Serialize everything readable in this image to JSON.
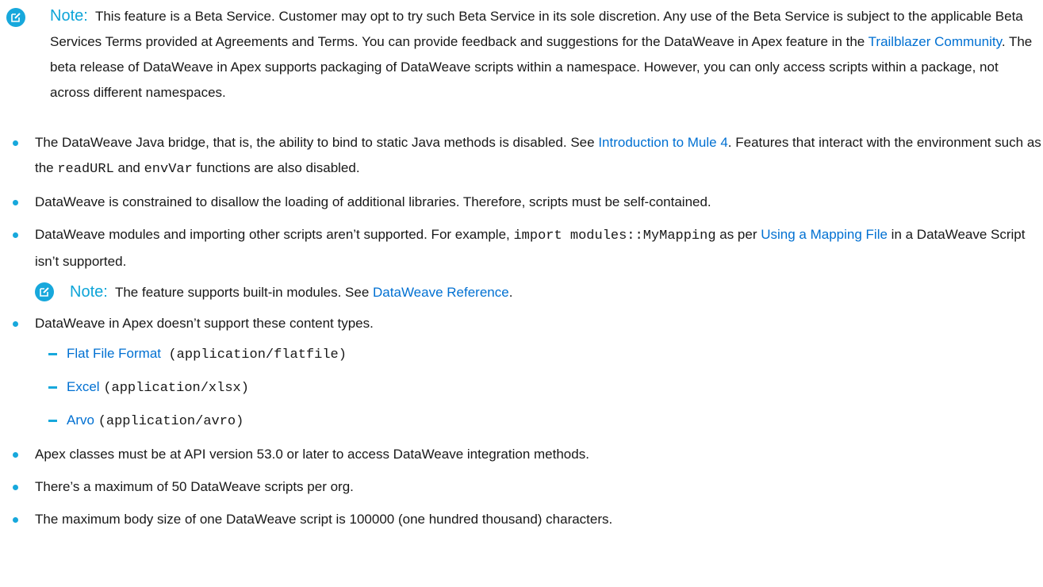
{
  "note_top": {
    "label": "Note:",
    "part1": "This feature is a Beta Service. Customer may opt to try such Beta Service in its sole discretion. Any use of the Beta Service is subject to the applicable Beta Services Terms provided at Agreements and Terms. You can provide feedback and suggestions for the DataWeave in Apex feature in the ",
    "link": "Trailblazer Community",
    "part2": ". The beta release of DataWeave in Apex supports packaging of DataWeave scripts within a namespace. However, you can only access scripts within a package, not across different namespaces."
  },
  "bullet1": {
    "t1": "The DataWeave Java bridge, that is, the ability to bind to static Java methods is disabled. See ",
    "link": "Introduction to Mule 4",
    "t2": ". Features that interact with the environment such as the ",
    "code1": "readURL",
    "t3": " and ",
    "code2": "envVar",
    "t4": " functions are also disabled."
  },
  "bullet2": "DataWeave is constrained to disallow the loading of additional libraries. Therefore, scripts must be self-contained.",
  "bullet3": {
    "t1": "DataWeave modules and importing other scripts aren’t supported. For example, ",
    "code": "import modules::MyMapping",
    "t2": " as per ",
    "link": "Using a Mapping File",
    "t3": " in a DataWeave Script isn’t supported.",
    "note_label": "Note:",
    "note_text": "The feature supports built-in modules. See ",
    "note_link": "DataWeave Reference",
    "note_end": "."
  },
  "bullet4": {
    "text": "DataWeave in Apex doesn’t support these content types.",
    "items": [
      {
        "link": "Flat File Format",
        "code": "(application/flatfile)"
      },
      {
        "link": "Excel",
        "code": "(application/xlsx)"
      },
      {
        "link": "Arvo",
        "code": "(application/avro)"
      }
    ]
  },
  "bullet5": "Apex classes must be at API version 53.0 or later to access DataWeave integration methods.",
  "bullet6": "There’s a maximum of 50 DataWeave scripts per org.",
  "bullet7": "The maximum body size of one DataWeave script is 100000 (one hundred thousand) characters.",
  "colors": {
    "accent": "#17a8dc",
    "link": "#0070d2",
    "text": "#181818"
  },
  "icons": {
    "note": "edit-note-icon"
  }
}
